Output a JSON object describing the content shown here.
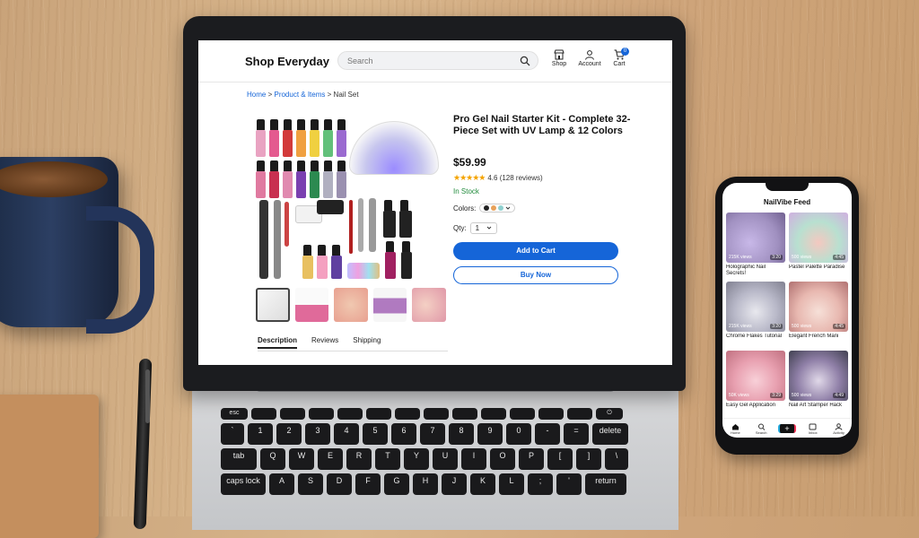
{
  "site": {
    "logo": "Shop Everyday",
    "search_placeholder": "Search",
    "nav": {
      "shop": "Shop",
      "account": "Account",
      "cart": "Cart",
      "cart_count": "0"
    }
  },
  "breadcrumb": {
    "home": "Home",
    "category": "Product & Items",
    "current": "Nail Set",
    "sep": ">"
  },
  "product": {
    "title": "Pro Gel Nail Starter Kit - Complete 32-Piece Set with UV Lamp & 12 Colors",
    "price": "$59.99",
    "stars": "★★★★★",
    "rating": "4.6 (128 reviews)",
    "stock": "In Stock",
    "colors_label": "Colors:",
    "color_swatches": [
      "#222222",
      "#e8a15a",
      "#8fd0cf"
    ],
    "qty_label": "Qty:",
    "qty_value": "1",
    "add_to_cart": "Add to Cart",
    "buy_now": "Buy Now"
  },
  "tabs": [
    "Description",
    "Reviews",
    "Shipping"
  ],
  "phone": {
    "feed_title": "NailVibe Feed",
    "videos": [
      {
        "views": "215K views",
        "duration": "3:20",
        "title": "Holographic Nail Secrets!"
      },
      {
        "views": "500 views",
        "duration": "4:45",
        "title": "Pastel Palette Paradise"
      },
      {
        "views": "215K views",
        "duration": "3:20",
        "title": "Chrome Flakes Tutorial"
      },
      {
        "views": "500 views",
        "duration": "4:45",
        "title": "Elegant French Mani"
      },
      {
        "views": "50K views",
        "duration": "3:29",
        "title": "Easy Gel Application"
      },
      {
        "views": "500 views",
        "duration": "4:49",
        "title": "Nail Art Stamper Hack"
      }
    ],
    "nav": [
      "Home",
      "Search",
      "",
      "Inbox",
      "Activity"
    ]
  },
  "keyboard": {
    "fn_row": [
      "esc",
      "",
      "",
      "",
      "",
      "",
      "",
      "",
      "",
      "",
      "",
      "",
      "",
      ""
    ],
    "row1": [
      "`",
      "1",
      "2",
      "3",
      "4",
      "5",
      "6",
      "7",
      "8",
      "9",
      "0",
      "-",
      "=",
      "delete"
    ],
    "row2": [
      "tab",
      "Q",
      "W",
      "E",
      "R",
      "T",
      "Y",
      "U",
      "I",
      "O",
      "P",
      "[",
      "]",
      "\\"
    ],
    "row3": [
      "caps lock",
      "A",
      "S",
      "D",
      "F",
      "G",
      "H",
      "J",
      "K",
      "L",
      ";",
      "'",
      "return"
    ]
  }
}
